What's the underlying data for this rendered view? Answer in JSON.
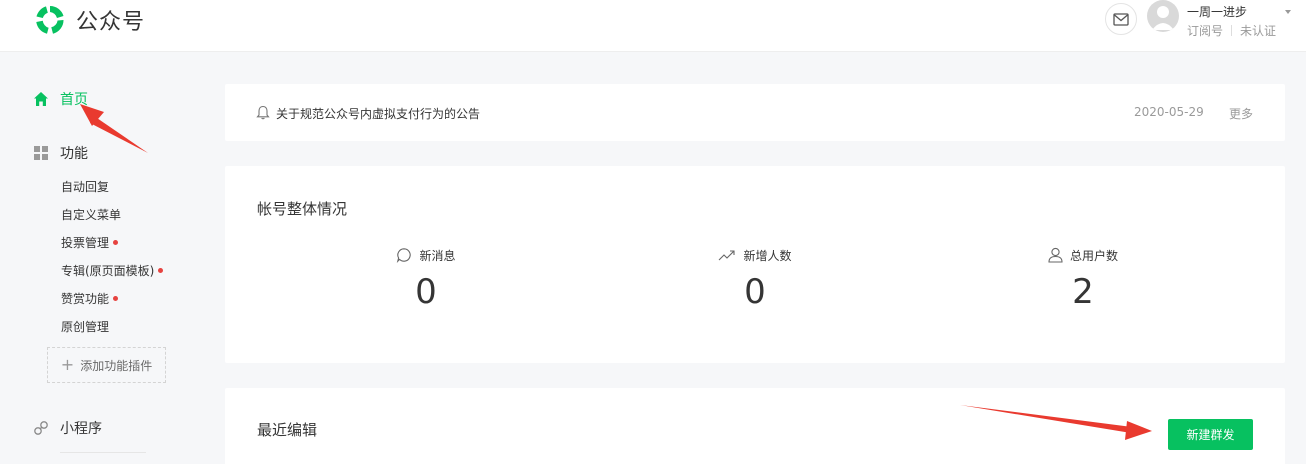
{
  "header": {
    "logo_text": "公众号",
    "account_name": "一周一进步",
    "account_type": "订阅号",
    "verify_status": "未认证"
  },
  "sidebar": {
    "home": "首页",
    "functions": "功能",
    "function_items": [
      {
        "label": "自动回复",
        "dot": false
      },
      {
        "label": "自定义菜单",
        "dot": false
      },
      {
        "label": "投票管理",
        "dot": true
      },
      {
        "label": "专辑(原页面模板)",
        "dot": true
      },
      {
        "label": "赞赏功能",
        "dot": true
      },
      {
        "label": "原创管理",
        "dot": false
      }
    ],
    "add_plugin": "添加功能插件",
    "mini_program": "小程序"
  },
  "notice": {
    "text": "关于规范公众号内虚拟支付行为的公告",
    "date": "2020-05-29",
    "more": "更多"
  },
  "overview": {
    "title": "帐号整体情况",
    "stats": [
      {
        "icon": "message-icon",
        "label": "新消息",
        "value": "0"
      },
      {
        "icon": "trend-icon",
        "label": "新增人数",
        "value": "0"
      },
      {
        "icon": "user-icon",
        "label": "总用户数",
        "value": "2"
      }
    ]
  },
  "recent": {
    "title": "最近编辑",
    "new_button": "新建群发"
  },
  "colors": {
    "brand_green": "#07c160",
    "annotation_red": "#e93a2f",
    "badge_red": "#e64340"
  }
}
